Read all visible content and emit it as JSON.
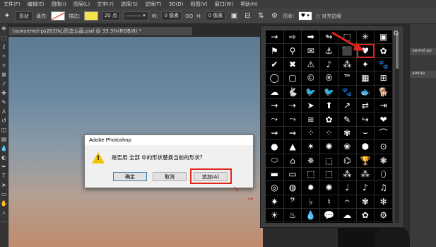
{
  "menu": [
    "文件(F)",
    "编辑(E)",
    "图像(I)",
    "图层(L)",
    "文字(Y)",
    "选择(S)",
    "滤镜(T)",
    "3D(D)",
    "视图(V)",
    "窗口(W)",
    "帮助(H)"
  ],
  "options": {
    "mode": "形状",
    "fill_label": "填充:",
    "stroke_label": "描边:",
    "stroke_size": "20 点",
    "w_label": "W:",
    "w_value": "0 像素",
    "link_icon": "GO",
    "h_label": "H:",
    "h_value": "0 像素",
    "shape_label": "形状:",
    "align_edges": "对齐边缘",
    "fill_color": "#ffffff",
    "stroke_color": "#f4e24a"
  },
  "document_tab": "taoxuemei-ps2020心形怎么画.psd @ 33.3%(RGB/8) *",
  "right_panel": {
    "tab1": "uemei-ps",
    "tab2": "aoxue"
  },
  "shape_picker": {
    "shapes": [
      "→",
      "⇨",
      "➡",
      "↬",
      "⬚",
      "✳",
      "▣",
      "⚑",
      "⚲",
      "✉",
      "⚓",
      "⬛",
      "♥",
      "✿",
      "✔",
      "✖",
      "⚠",
      "♪",
      "⁂",
      "✦",
      "🐾",
      "◯",
      "▢",
      "©",
      "®",
      "™",
      "▦",
      "⊞",
      "☁",
      "🐇",
      "🐦",
      "🐦",
      "🐾",
      "🐟",
      "🐕",
      "→",
      "⇢",
      "➤",
      "⬆",
      "↗",
      "⇄",
      "⇥",
      "⤳",
      "⤳",
      "≋",
      "✿",
      "✎",
      "↪",
      "❤",
      "⇝",
      "⇝",
      "⁘",
      "⁘",
      "✾",
      "⌣",
      "⌒",
      "●",
      "▲",
      "✶",
      "✺",
      "❀",
      "⬢",
      "⊙",
      "⬭",
      "⌂",
      "✵",
      "⬚",
      "⌬",
      "🏆",
      "❃",
      "▬",
      "▭",
      "⬚",
      "⬚",
      "⁂",
      "⁂",
      "⬯",
      "◎",
      "◍",
      "✹",
      "✺",
      "♩",
      "♪",
      "♫",
      "✷",
      "𝄢",
      "♭",
      "♮",
      "𝄐",
      "✾",
      "✻",
      "☀",
      "♨",
      "💧",
      "💬",
      "☁",
      "✿",
      "⚙"
    ],
    "selected_shape": "heart",
    "gear_icon": "gear-icon"
  },
  "dialog": {
    "title": "Adobe Photoshop",
    "message": "是否用 全部 中的形状替换当前的形状?",
    "ok": "确定",
    "cancel": "取消",
    "append": "追加(A)"
  },
  "annotations": {
    "highlight_color": "#e0261c"
  }
}
